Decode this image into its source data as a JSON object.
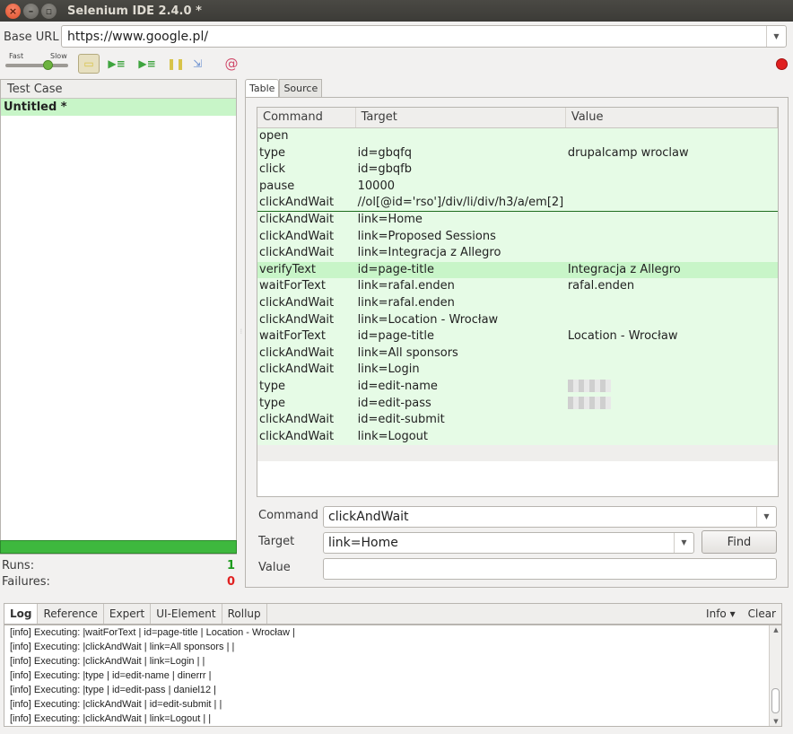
{
  "window": {
    "title": "Selenium IDE 2.4.0 *"
  },
  "base_url": {
    "label": "Base URL",
    "value": "https://www.google.pl/"
  },
  "speed": {
    "fast_label": "Fast",
    "slow_label": "Slow"
  },
  "test_case": {
    "header": "Test Case",
    "items": [
      "Untitled *"
    ]
  },
  "stats": {
    "runs_label": "Runs:",
    "runs_value": "1",
    "failures_label": "Failures:",
    "failures_value": "0"
  },
  "tabs": [
    "Table",
    "Source"
  ],
  "table": {
    "headers": [
      "Command",
      "Target",
      "Value"
    ],
    "rows": [
      {
        "command": "open",
        "target": "",
        "value": ""
      },
      {
        "command": "type",
        "target": "id=gbqfq",
        "value": "drupalcamp wroclaw"
      },
      {
        "command": "click",
        "target": "id=gbqfb",
        "value": ""
      },
      {
        "command": "pause",
        "target": "10000",
        "value": ""
      },
      {
        "command": "clickAndWait",
        "target": "//ol[@id='rso']/div/li/div/h3/a/em[2]",
        "value": ""
      },
      {
        "command": "clickAndWait",
        "target": "link=Home",
        "value": ""
      },
      {
        "command": "clickAndWait",
        "target": "link=Proposed Sessions",
        "value": ""
      },
      {
        "command": "clickAndWait",
        "target": "link=Integracja z Allegro",
        "value": ""
      },
      {
        "command": "verifyText",
        "target": "id=page-title",
        "value": "Integracja z Allegro"
      },
      {
        "command": "waitForText",
        "target": "link=rafal.enden",
        "value": "rafal.enden"
      },
      {
        "command": "clickAndWait",
        "target": "link=rafal.enden",
        "value": ""
      },
      {
        "command": "clickAndWait",
        "target": "link=Location - Wrocław",
        "value": ""
      },
      {
        "command": "waitForText",
        "target": "id=page-title",
        "value": "Location - Wrocław"
      },
      {
        "command": "clickAndWait",
        "target": "link=All sponsors",
        "value": ""
      },
      {
        "command": "clickAndWait",
        "target": "link=Login",
        "value": ""
      },
      {
        "command": "type",
        "target": "id=edit-name",
        "value": ""
      },
      {
        "command": "type",
        "target": "id=edit-pass",
        "value": ""
      },
      {
        "command": "clickAndWait",
        "target": "id=edit-submit",
        "value": ""
      },
      {
        "command": "clickAndWait",
        "target": "link=Logout",
        "value": ""
      }
    ]
  },
  "editor": {
    "command_label": "Command",
    "command_value": "clickAndWait",
    "target_label": "Target",
    "target_value": "link=Home",
    "value_label": "Value",
    "value_value": "",
    "find_label": "Find"
  },
  "log": {
    "tabs": [
      "Log",
      "Reference",
      "Expert",
      "UI-Element",
      "Rollup"
    ],
    "info_label": "Info ▾",
    "clear_label": "Clear",
    "lines": [
      "[info] Executing: |waitForText | id=page-title | Location - Wrocław |",
      "[info] Executing: |clickAndWait | link=All sponsors | |",
      "[info] Executing: |clickAndWait | link=Login | |",
      "[info] Executing: |type | id=edit-name | dinerrr |",
      "[info] Executing: |type | id=edit-pass | daniel12 |",
      "[info] Executing: |clickAndWait | id=edit-submit | |",
      "[info] Executing: |clickAndWait | link=Logout | |"
    ]
  },
  "colors": {
    "accent_green": "#3eb83e",
    "row_green": "#e6fbe6",
    "selected_green": "#c8f5c8",
    "record_red": "#e02020"
  }
}
